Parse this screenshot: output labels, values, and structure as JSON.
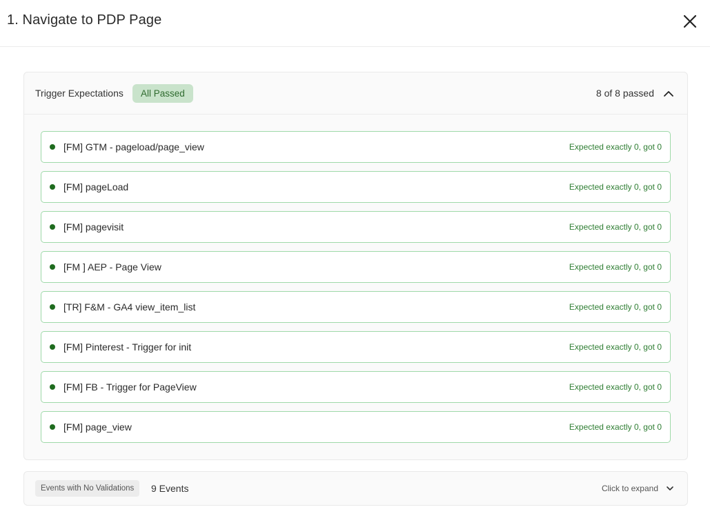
{
  "header": {
    "title": "1. Navigate to PDP Page",
    "close_icon": "close-icon"
  },
  "trigger_panel": {
    "title": "Trigger Expectations",
    "badge": "All Passed",
    "passed_count": "8 of 8 passed",
    "toggle_icon": "chevron-up-icon",
    "colors": {
      "badge_bg": "#c9e3cb",
      "badge_text": "#2f6b2f",
      "row_border": "#9ed9a8",
      "dot": "#1f6b1f",
      "status_text": "#2e7d32"
    },
    "rows": [
      {
        "label": "[FM] GTM - pageload/page_view",
        "status": "Expected exactly 0, got 0"
      },
      {
        "label": "[FM] pageLoad",
        "status": "Expected exactly 0, got 0"
      },
      {
        "label": "[FM] pagevisit",
        "status": "Expected exactly 0, got 0"
      },
      {
        "label": "[FM ] AEP - Page View",
        "status": "Expected exactly 0, got 0"
      },
      {
        "label": "[TR] F&M - GA4 view_item_list",
        "status": "Expected exactly 0, got 0"
      },
      {
        "label": "[FM] Pinterest - Trigger for init",
        "status": "Expected exactly 0, got 0"
      },
      {
        "label": "[FM] FB - Trigger for PageView",
        "status": "Expected exactly 0, got 0"
      },
      {
        "label": "[FM] page_view",
        "status": "Expected exactly 0, got 0"
      }
    ]
  },
  "events_panel": {
    "tag": "Events with No Validations",
    "count": "9 Events",
    "expand_text": "Click to expand",
    "toggle_icon": "chevron-down-icon"
  }
}
